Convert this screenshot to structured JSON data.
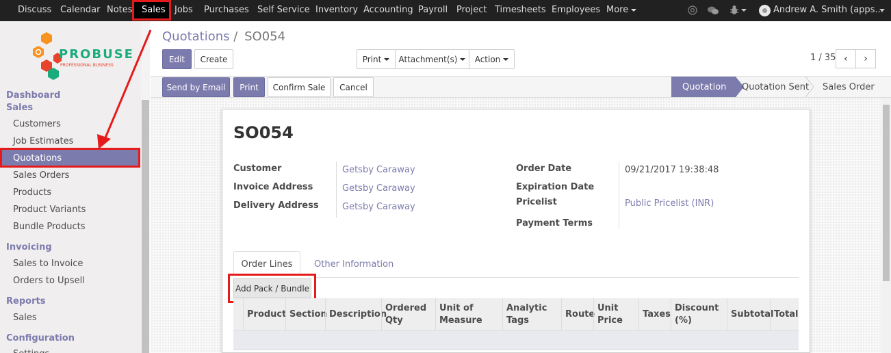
{
  "topbar": {
    "menu": [
      "Discuss",
      "Calendar",
      "Notes",
      "Sales",
      "Jobs",
      "Purchases",
      "Self Service",
      "Inventory",
      "Accounting",
      "Payroll",
      "Project",
      "Timesheets",
      "Employees",
      "More"
    ],
    "user": "Andrew A. Smith (apps...",
    "icons": [
      "at-icon",
      "chat-icon",
      "bug-icon"
    ]
  },
  "sidebar": {
    "logo_text": "PROBUSE",
    "logo_sub": "PROFESSIONAL BUSINESS",
    "sections": {
      "dashboard": "Dashboard",
      "sales": "Sales",
      "invoicing": "Invoicing",
      "reports": "Reports",
      "configuration": "Configuration"
    },
    "items": {
      "customers": "Customers",
      "job_estimates": "Job Estimates",
      "quotations": "Quotations",
      "sales_orders": "Sales Orders",
      "products": "Products",
      "product_variants": "Product Variants",
      "bundle_products": "Bundle Products",
      "sales_to_invoice": "Sales to Invoice",
      "orders_to_upsell": "Orders to Upsell",
      "reports_sales": "Sales",
      "settings": "Settings"
    }
  },
  "breadcrumb": {
    "parent": "Quotations",
    "separator": "/",
    "current": "SO054"
  },
  "toolbar": {
    "edit": "Edit",
    "create": "Create",
    "print": "Print",
    "attachments": "Attachment(s)",
    "action": "Action",
    "pager": "1 / 35",
    "prev": "‹",
    "next": "›"
  },
  "statusbar": {
    "send_email": "Send by Email",
    "print": "Print",
    "confirm": "Confirm Sale",
    "cancel": "Cancel",
    "stages": [
      "Quotation",
      "Quotation Sent",
      "Sales Order"
    ],
    "active_stage": "Quotation"
  },
  "form": {
    "title": "SO054",
    "customer_label": "Customer",
    "customer": "Getsby Caraway",
    "invoice_label": "Invoice Address",
    "invoice": "Getsby Caraway",
    "delivery_label": "Delivery Address",
    "delivery": "Getsby Caraway",
    "order_date_label": "Order Date",
    "order_date": "09/21/2017 19:38:48",
    "expiration_label": "Expiration Date",
    "pricelist_label": "Pricelist",
    "pricelist": "Public Pricelist (INR)",
    "payment_terms_label": "Payment Terms"
  },
  "tabs": [
    "Order Lines",
    "Other Information"
  ],
  "add_pack": "Add Pack / Bundle",
  "table": {
    "columns": [
      "Product",
      "Section",
      "Description",
      "Ordered Qty",
      "Unit of Measure",
      "Analytic Tags",
      "Route",
      "Unit Price",
      "Taxes",
      "Discount (%)",
      "Subtotal",
      "Total"
    ]
  },
  "colors": {
    "accent": "#7c7bad",
    "highlight": "#e51b1b",
    "topbar": "#212121"
  }
}
